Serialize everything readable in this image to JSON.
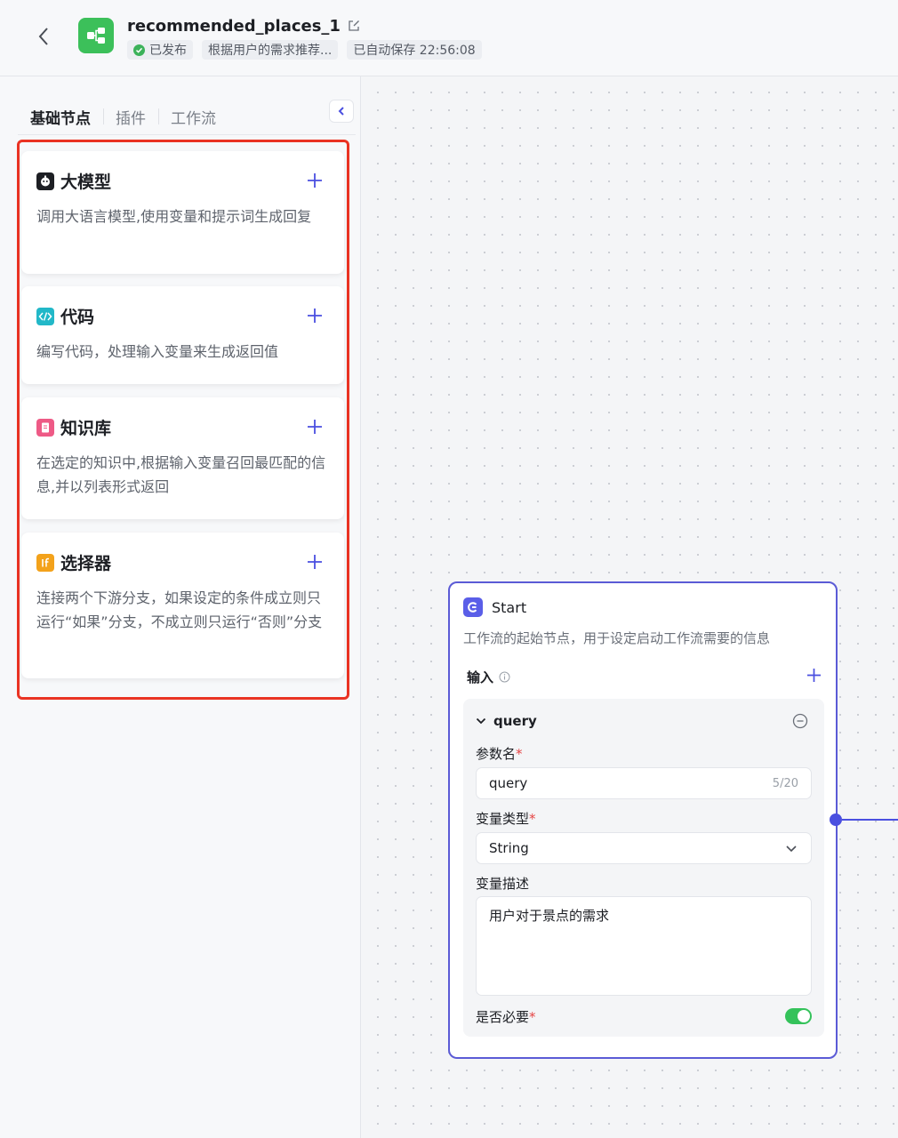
{
  "header": {
    "title": "recommended_places_1",
    "status": "已发布",
    "description": "根据用户的需求推荐...",
    "autosave": "已自动保存 22:56:08"
  },
  "tabs": [
    {
      "label": "基础节点"
    },
    {
      "label": "插件"
    },
    {
      "label": "工作流"
    }
  ],
  "nodes": [
    {
      "title": "大模型",
      "description": "调用大语言模型,使用变量和提示词生成回复",
      "icon": "robot-icon"
    },
    {
      "title": "代码",
      "description": "编写代码，处理输入变量来生成返回值",
      "icon": "code-icon"
    },
    {
      "title": "知识库",
      "description": "在选定的知识中,根据输入变量召回最匹配的信息,并以列表形式返回",
      "icon": "knowledge-icon"
    },
    {
      "title": "选择器",
      "description": "连接两个下游分支，如果设定的条件成立则只运行“如果”分支，不成立则只运行“否则”分支",
      "icon": "if-icon"
    }
  ],
  "start_node": {
    "title": "Start",
    "description": "工作流的起始节点，用于设定启动工作流需要的信息",
    "input_label": "输入",
    "param": {
      "name": "query",
      "name_label": "参数名",
      "name_value": "query",
      "name_counter": "5/20",
      "type_label": "变量类型",
      "type_value": "String",
      "desc_label": "变量描述",
      "desc_value": "用户对于景点的需求",
      "required_label": "是否必要",
      "required": true
    }
  },
  "colors": {
    "accent": "#5b5bd6",
    "highlight_border": "#ea3323",
    "toggle_on": "#34c25a",
    "app_icon": "#3cc05a"
  }
}
